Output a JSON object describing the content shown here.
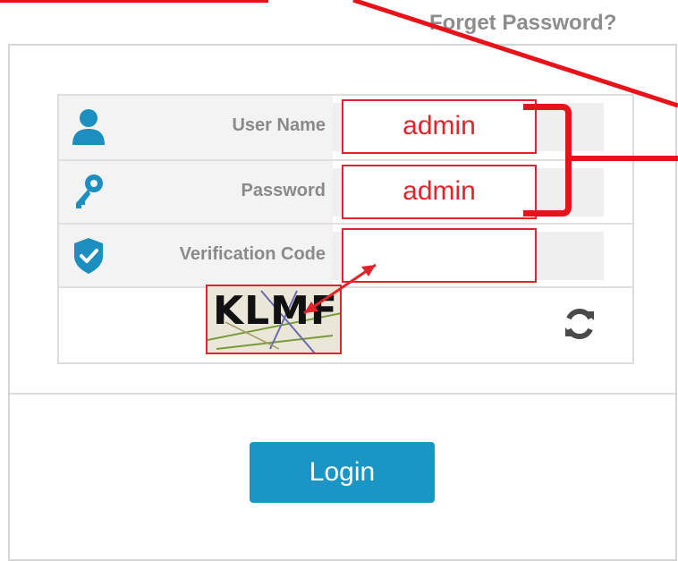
{
  "header": {
    "forget_password": "Forget Password?"
  },
  "form": {
    "rows": [
      {
        "label": "User Name",
        "value": "admin",
        "icon": "user-icon"
      },
      {
        "label": "Password",
        "value": "admin",
        "icon": "key-icon"
      },
      {
        "label": "Verification Code",
        "value": "",
        "icon": "shield-check-icon"
      }
    ],
    "captcha_text": "KLMF",
    "refresh_icon": "refresh-icon"
  },
  "actions": {
    "login_label": "Login"
  },
  "colors": {
    "accent": "#1996c5",
    "annotation_red": "#e3232a",
    "label_gray": "#8a8a8a"
  }
}
